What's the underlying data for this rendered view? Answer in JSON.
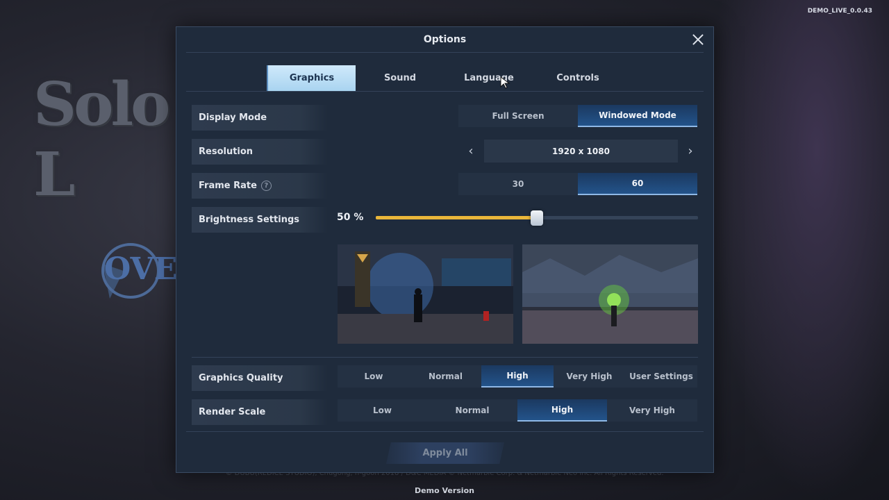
{
  "background": {
    "logo_text": "Solo L",
    "emblem_text": "OVE",
    "version": "DEMO_LIVE_0.0.43",
    "copyright": "© DUBU(REDICE STUDIO), Chugong, h-goon 2018 / D&C MEDIA © Netmarble Corp. & Netmarble Neo Inc. All Rights Reserved.",
    "demo_label": "Demo Version"
  },
  "dialog": {
    "title": "Options",
    "tabs": [
      {
        "label": "Graphics",
        "active": true
      },
      {
        "label": "Sound",
        "active": false
      },
      {
        "label": "Language",
        "active": false
      },
      {
        "label": "Controls",
        "active": false
      }
    ],
    "display_mode": {
      "label": "Display Mode",
      "options": [
        "Full Screen",
        "Windowed Mode"
      ],
      "selected": "Windowed Mode"
    },
    "resolution": {
      "label": "Resolution",
      "value": "1920 x 1080"
    },
    "frame_rate": {
      "label": "Frame Rate",
      "help_glyph": "?",
      "options": [
        "30",
        "60"
      ],
      "selected": "60"
    },
    "brightness": {
      "label": "Brightness Settings",
      "value_text": "50 %",
      "level_fraction": 0.5
    },
    "graphics_quality": {
      "label": "Graphics Quality",
      "options": [
        "Low",
        "Normal",
        "High",
        "Very High",
        "User Settings"
      ],
      "selected": "High"
    },
    "render_scale": {
      "label": "Render Scale",
      "options": [
        "Low",
        "Normal",
        "High",
        "Very High"
      ],
      "selected": "High"
    },
    "apply_label": "Apply All"
  },
  "colors": {
    "panel_bg": "#1f2b3c",
    "active_tab": "#bfe0f7",
    "active_segment": "#23538a",
    "slider_fill": "#e9b63a"
  }
}
